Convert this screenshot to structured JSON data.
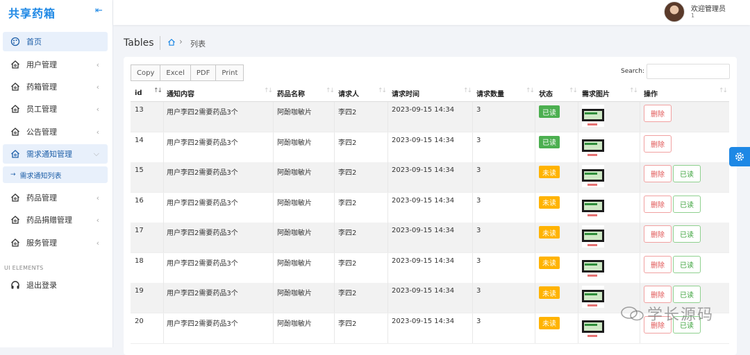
{
  "brand": "共享药箱",
  "sidebar": {
    "items": [
      {
        "label": "首页",
        "icon": "palette-icon"
      },
      {
        "label": "用户管理",
        "icon": "home-icon"
      },
      {
        "label": "药箱管理",
        "icon": "home-icon"
      },
      {
        "label": "员工管理",
        "icon": "home-icon"
      },
      {
        "label": "公告管理",
        "icon": "home-icon"
      },
      {
        "label": "需求通知管理",
        "icon": "home-icon"
      },
      {
        "label": "药品管理",
        "icon": "home-icon"
      },
      {
        "label": "药品捐赠管理",
        "icon": "home-icon"
      },
      {
        "label": "服务管理",
        "icon": "home-icon"
      }
    ],
    "sub_item": "需求通知列表",
    "section_label": "UI ELEMENTS",
    "logout": "退出登录"
  },
  "topbar": {
    "welcome": "欢迎管理员",
    "welcome_sub": "1"
  },
  "page": {
    "title": "Tables",
    "breadcrumb": "列表"
  },
  "toolbar": {
    "copy": "Copy",
    "excel": "Excel",
    "pdf": "PDF",
    "print": "Print",
    "search_label": "Search:"
  },
  "table": {
    "columns": [
      "id",
      "通知内容",
      "药品名称",
      "请求人",
      "请求时间",
      "请求数量",
      "状态",
      "需求图片",
      "操作"
    ],
    "rows": [
      {
        "id": "13",
        "content": "用户李四2需要药品3个",
        "drug": "阿酚咖敏片",
        "user": "李四2",
        "time": "2023-09-15 14:34",
        "qty": "3",
        "status": "已读"
      },
      {
        "id": "14",
        "content": "用户李四2需要药品3个",
        "drug": "阿酚咖敏片",
        "user": "李四2",
        "time": "2023-09-15 14:34",
        "qty": "3",
        "status": "已读"
      },
      {
        "id": "15",
        "content": "用户李四2需要药品3个",
        "drug": "阿酚咖敏片",
        "user": "李四2",
        "time": "2023-09-15 14:34",
        "qty": "3",
        "status": "未读"
      },
      {
        "id": "16",
        "content": "用户李四2需要药品3个",
        "drug": "阿酚咖敏片",
        "user": "李四2",
        "time": "2023-09-15 14:34",
        "qty": "3",
        "status": "未读"
      },
      {
        "id": "17",
        "content": "用户李四2需要药品3个",
        "drug": "阿酚咖敏片",
        "user": "李四2",
        "time": "2023-09-15 14:34",
        "qty": "3",
        "status": "未读"
      },
      {
        "id": "18",
        "content": "用户李四2需要药品3个",
        "drug": "阿酚咖敏片",
        "user": "李四2",
        "time": "2023-09-15 14:34",
        "qty": "3",
        "status": "未读"
      },
      {
        "id": "19",
        "content": "用户李四2需要药品3个",
        "drug": "阿酚咖敏片",
        "user": "李四2",
        "time": "2023-09-15 14:34",
        "qty": "3",
        "status": "未读"
      },
      {
        "id": "20",
        "content": "用户李四2需要药品3个",
        "drug": "阿酚咖敏片",
        "user": "李四2",
        "time": "2023-09-15 14:34",
        "qty": "3",
        "status": "未读"
      }
    ],
    "delete_label": "删除",
    "read_label": "已读"
  },
  "colors": {
    "accent": "#1e88e5",
    "status_read": "#4caf50",
    "status_unread": "#ffb300",
    "delete": "#e05555",
    "read_button": "#3ca33c"
  },
  "watermark": "学长源码"
}
